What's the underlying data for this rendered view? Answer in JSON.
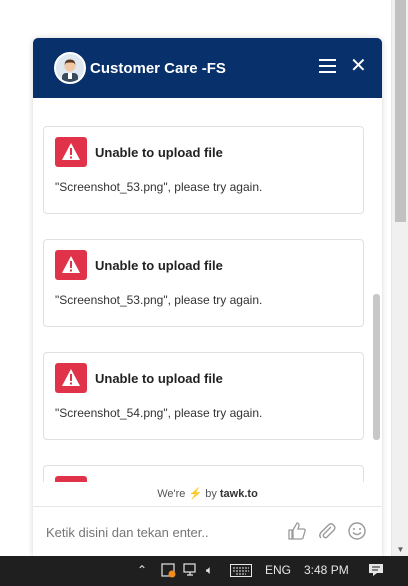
{
  "header": {
    "title": "Customer Care -FS"
  },
  "messages": [
    {
      "title": "Unable to upload file",
      "text": "\"Screenshot_53.png\", please try again."
    },
    {
      "title": "Unable to upload file",
      "text": "\"Screenshot_53.png\", please try again."
    },
    {
      "title": "Unable to upload file",
      "text": "\"Screenshot_54.png\", please try again."
    }
  ],
  "powered_by": {
    "prefix": "We're",
    "middle": "by",
    "brand": "tawk.to"
  },
  "composer": {
    "placeholder": "Ketik disini dan tekan enter.."
  },
  "taskbar": {
    "language": "ENG",
    "time": "3:48 PM"
  },
  "colors": {
    "header_bg": "#08306b",
    "error_red": "#e0334a",
    "bolt": "#f2b600"
  }
}
